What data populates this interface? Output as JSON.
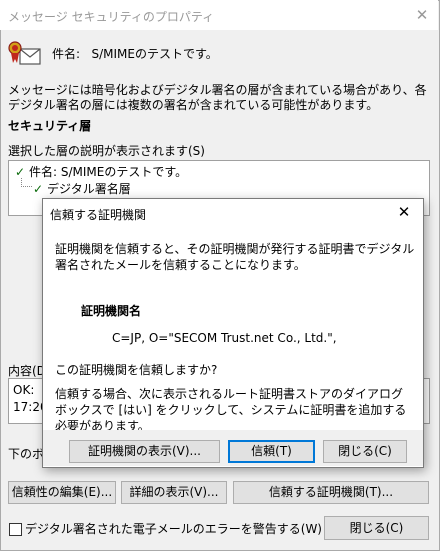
{
  "window": {
    "title": "メッセージ セキュリティのプロパティ",
    "subject_label": "件名:",
    "subject_value": "S/MIMEのテストです。",
    "description": "メッセージには暗号化およびデジタル署名の層が含まれている場合があり、各デジタル署名の層には複数の署名が含まれている可能性があります。",
    "security_layer_heading": "セキュリティ層",
    "tree_label": "選択した層の説明が表示されます(S)",
    "tree_items": [
      {
        "label": "件名: S/MIMEのテストです。"
      },
      {
        "label": "デジタル署名層"
      }
    ],
    "details_label": "内容(D",
    "details_lines": [
      "OK:",
      "17:20"
    ],
    "lower_label": "下のボ",
    "buttons": {
      "edit_trust": "信頼性の編集(E)...",
      "view_details": "詳細の表示(V)...",
      "trust_ca": "信頼する証明機関(T)...",
      "close": "閉じる(C)"
    },
    "warn_checkbox_label": "デジタル署名された電子メールのエラーを警告する(W)",
    "warn_checked": false
  },
  "dialog": {
    "title": "信頼する証明機関",
    "message": "証明機関を信頼すると、その証明機関が発行する証明書でデジタル署名されたメールを信頼することになります。",
    "ca_name_heading": "証明機関名",
    "ca_name": "C=JP, O=\"SECOM Trust.net Co., Ltd.\",",
    "question": "この証明機関を信頼しますか?",
    "note": "信頼する場合、次に表示されるルート証明書ストアのダイアログ ボックスで [はい] をクリックして、システムに証明書を追加する必要があります。",
    "buttons": {
      "view_ca": "証明機関の表示(V)...",
      "trust": "信頼(T)",
      "close": "閉じる(C)"
    }
  },
  "colors": {
    "accent": "#0078d7",
    "check": "#0a6a0a"
  }
}
